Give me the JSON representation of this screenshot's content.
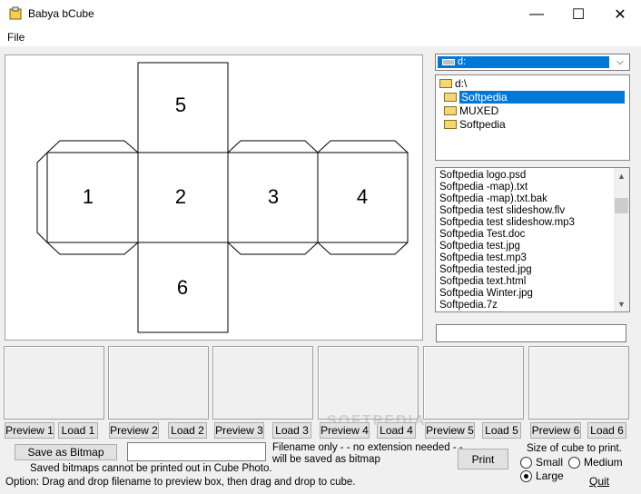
{
  "window": {
    "title": "Babya bCube",
    "minimize": "—",
    "maximize": "☐",
    "close": "✕"
  },
  "menu": {
    "file": "File"
  },
  "cube": {
    "faces": [
      "1",
      "2",
      "3",
      "4",
      "5",
      "6"
    ]
  },
  "drive": {
    "selected": "d:"
  },
  "directories": [
    {
      "label": "d:\\",
      "selected": false
    },
    {
      "label": "Softpedia",
      "selected": true
    },
    {
      "label": "MUXED",
      "selected": false
    },
    {
      "label": "Softpedia",
      "selected": false
    }
  ],
  "files": [
    "Softpedia logo.psd",
    "Softpedia -map).txt",
    "Softpedia -map).txt.bak",
    "Softpedia test slideshow.flv",
    "Softpedia test slideshow.mp3",
    "Softpedia Test.doc",
    "Softpedia test.jpg",
    "Softpedia test.mp3",
    "Softpedia tested.jpg",
    "Softpedia text.html",
    "Softpedia Winter.jpg",
    "Softpedia.7z"
  ],
  "filename_field": {
    "value": ""
  },
  "previews": [
    {
      "preview_label": "Preview 1",
      "load_label": "Load 1"
    },
    {
      "preview_label": "Preview 2",
      "load_label": "Load 2"
    },
    {
      "preview_label": "Preview 3",
      "load_label": "Load 3"
    },
    {
      "preview_label": "Preview 4",
      "load_label": "Load 4"
    },
    {
      "preview_label": "Preview 5",
      "load_label": "Load 5"
    },
    {
      "preview_label": "Preview 6",
      "load_label": "Load 6"
    }
  ],
  "bitmap": {
    "save_label": "Save as Bitmap",
    "field_value": "",
    "hint_line1": "Filename only - - no extension needed - -",
    "hint_line2": "will be saved as bitmap",
    "note": "Saved bitmaps cannot be printed out in Cube Photo."
  },
  "print": {
    "label": "Print",
    "size_label": "Size of cube to print.",
    "options": [
      "Small",
      "Medium",
      "Large"
    ],
    "selected": "Large"
  },
  "quit_label": "Quit",
  "option_text": "Option: Drag and drop filename to preview box, then drag and drop to cube.",
  "watermark": "SOFTPEDIA"
}
